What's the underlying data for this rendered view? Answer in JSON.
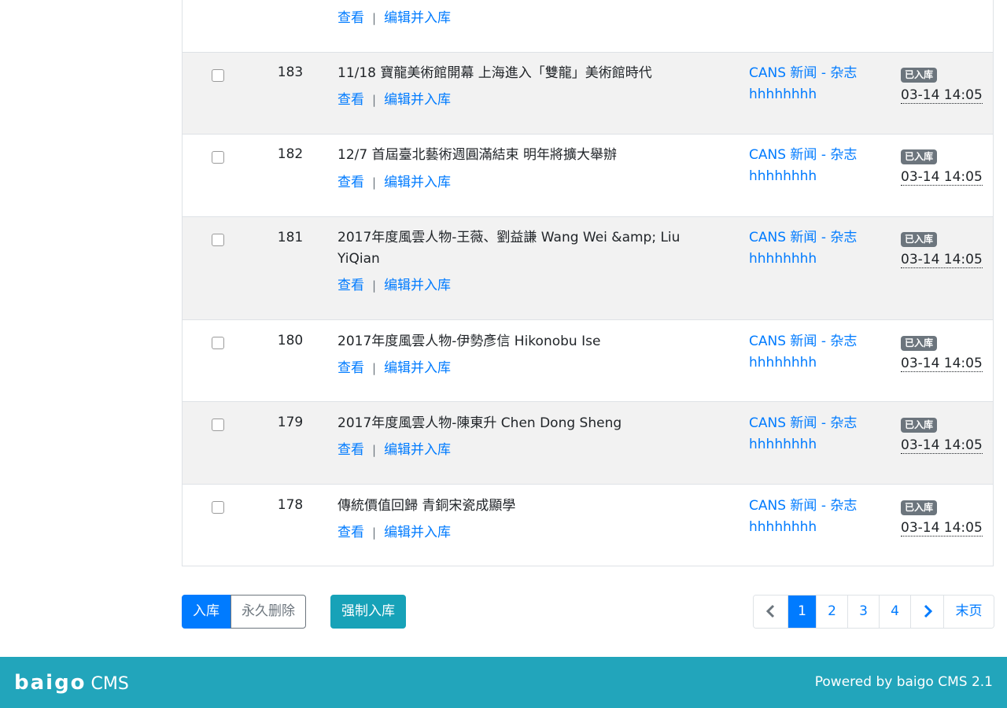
{
  "rows": [
    {
      "id": "",
      "title": "",
      "view": "查看",
      "edit": "编辑并入库",
      "category": "",
      "user": "",
      "badge": "",
      "time": ""
    },
    {
      "id": "183",
      "title": "11/18 寶龍美術館開幕 上海進入「雙龍」美術館時代",
      "view": "查看",
      "edit": "编辑并入库",
      "category": "CANS 新闻 - 杂志",
      "user": "hhhhhhhh",
      "badge": "已入库",
      "time": "03-14 14:05"
    },
    {
      "id": "182",
      "title": "12/7 首屆臺北藝術週圓滿結束 明年將擴大舉辦",
      "view": "查看",
      "edit": "编辑并入库",
      "category": "CANS 新闻 - 杂志",
      "user": "hhhhhhhh",
      "badge": "已入库",
      "time": "03-14 14:05"
    },
    {
      "id": "181",
      "title": "2017年度風雲人物-王薇、劉益謙 Wang Wei &amp; Liu YiQian",
      "view": "查看",
      "edit": "编辑并入库",
      "category": "CANS 新闻 - 杂志",
      "user": "hhhhhhhh",
      "badge": "已入库",
      "time": "03-14 14:05"
    },
    {
      "id": "180",
      "title": "2017年度風雲人物-伊勢彥信 Hikonobu Ise",
      "view": "查看",
      "edit": "编辑并入库",
      "category": "CANS 新闻 - 杂志",
      "user": "hhhhhhhh",
      "badge": "已入库",
      "time": "03-14 14:05"
    },
    {
      "id": "179",
      "title": "2017年度風雲人物-陳東升 Chen Dong Sheng",
      "view": "查看",
      "edit": "编辑并入库",
      "category": "CANS 新闻 - 杂志",
      "user": "hhhhhhhh",
      "badge": "已入库",
      "time": "03-14 14:05"
    },
    {
      "id": "178",
      "title": "傳統價值回歸 青銅宋瓷成顯學",
      "view": "查看",
      "edit": "编辑并入库",
      "category": "CANS 新闻 - 杂志",
      "user": "hhhhhhhh",
      "badge": "已入库",
      "time": "03-14 14:05"
    }
  ],
  "separator": "|",
  "buttons": {
    "store": "入库",
    "delete_forever": "永久删除",
    "force_store": "强制入库"
  },
  "pagination": {
    "prev": "‹",
    "pages": [
      "1",
      "2",
      "3",
      "4"
    ],
    "next": "›",
    "last": "末页",
    "active_page": "1"
  },
  "footer": {
    "logo": "baigo",
    "logo_suffix": "CMS",
    "powered": "Powered by baigo CMS 2.1"
  },
  "colors": {
    "primary": "#007bff",
    "info": "#17a2b8",
    "footer": "#22a5bb",
    "badge": "#6c757d"
  }
}
